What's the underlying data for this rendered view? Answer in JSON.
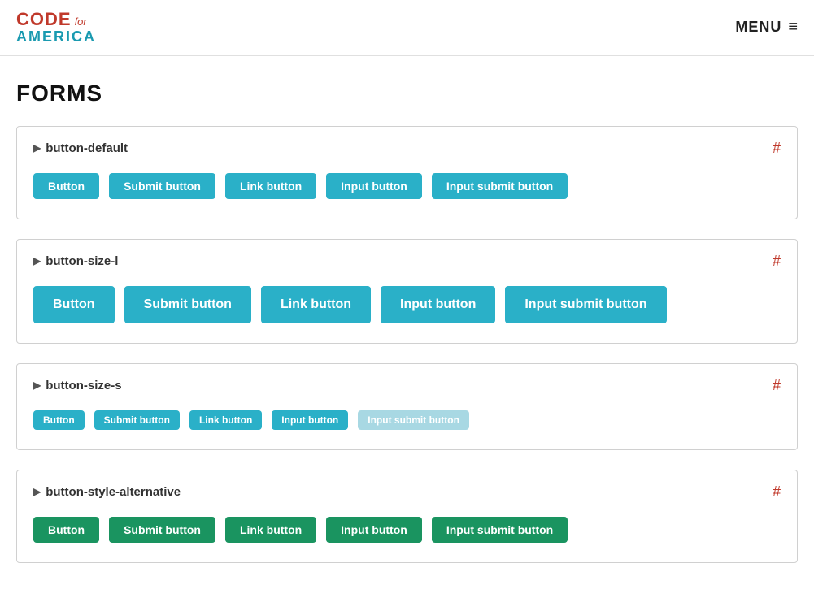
{
  "header": {
    "logo": {
      "code": "CODE",
      "for": "for",
      "america": "AMERICA"
    },
    "menu_label": "MENU",
    "menu_icon": "≡"
  },
  "page": {
    "title": "FORMS"
  },
  "sections": [
    {
      "id": "button-default",
      "title": "button-default",
      "anchor": "#",
      "size": "default",
      "style": "default",
      "buttons": [
        {
          "label": "Button",
          "type": "button"
        },
        {
          "label": "Submit button",
          "type": "submit"
        },
        {
          "label": "Link button",
          "type": "link"
        },
        {
          "label": "Input button",
          "type": "input"
        },
        {
          "label": "Input submit button",
          "type": "input-submit"
        }
      ]
    },
    {
      "id": "button-size-l",
      "title": "button-size-l",
      "anchor": "#",
      "size": "large",
      "style": "default",
      "buttons": [
        {
          "label": "Button",
          "type": "button"
        },
        {
          "label": "Submit button",
          "type": "submit"
        },
        {
          "label": "Link button",
          "type": "link"
        },
        {
          "label": "Input button",
          "type": "input"
        },
        {
          "label": "Input submit button",
          "type": "input-submit"
        }
      ]
    },
    {
      "id": "button-size-s",
      "title": "button-size-s",
      "anchor": "#",
      "size": "small",
      "style": "default",
      "buttons": [
        {
          "label": "Button",
          "type": "button",
          "faded": false
        },
        {
          "label": "Submit button",
          "type": "submit",
          "faded": false
        },
        {
          "label": "Link button",
          "type": "link",
          "faded": false
        },
        {
          "label": "Input button",
          "type": "input",
          "faded": false
        },
        {
          "label": "Input submit button",
          "type": "input-submit",
          "faded": true
        }
      ]
    },
    {
      "id": "button-style-alternative",
      "title": "button-style-alternative",
      "anchor": "#",
      "size": "default",
      "style": "alternative",
      "buttons": [
        {
          "label": "Button",
          "type": "button"
        },
        {
          "label": "Submit button",
          "type": "submit"
        },
        {
          "label": "Link button",
          "type": "link"
        },
        {
          "label": "Input button",
          "type": "input"
        },
        {
          "label": "Input submit button",
          "type": "input-submit"
        }
      ]
    }
  ]
}
